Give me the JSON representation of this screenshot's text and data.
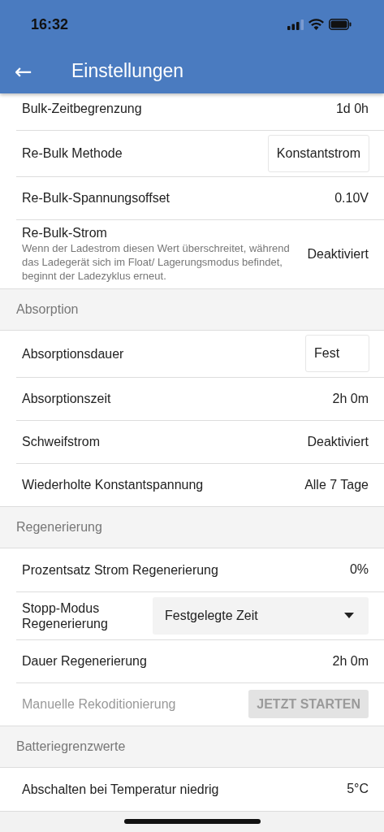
{
  "status_bar": {
    "time": "16:32"
  },
  "app_bar": {
    "back_icon": "←",
    "title": "Einstellungen"
  },
  "sections": [
    {
      "rows": [
        {
          "kind": "value",
          "label": "Bulk-Zeitbegrenzung",
          "value": "1d 0h"
        },
        {
          "kind": "box",
          "label": "Re-Bulk Methode",
          "value": "Konstantstrom"
        },
        {
          "kind": "value",
          "label": "Re-Bulk-Spannungsoffset",
          "value": "0.10V"
        },
        {
          "kind": "value",
          "label": "Re-Bulk-Strom",
          "description": "Wenn der Ladestrom diesen Wert überschreitet, während das Ladegerät sich im Float/ Lagerungsmodus befindet, beginnt der Ladezyklus erneut.",
          "value": "Deaktiviert"
        }
      ]
    },
    {
      "title": "Absorption",
      "rows": [
        {
          "kind": "box",
          "label": "Absorptionsdauer",
          "value": "Fest"
        },
        {
          "kind": "value",
          "label": "Absorptionszeit",
          "value": "2h 0m"
        },
        {
          "kind": "value",
          "label": "Schweifstrom",
          "value": "Deaktiviert"
        },
        {
          "kind": "value",
          "label": "Wiederholte Konstantspannung",
          "value": "Alle 7 Tage"
        }
      ]
    },
    {
      "title": "Regenerierung",
      "rows": [
        {
          "kind": "value",
          "label": "Prozentsatz Strom Regenerierung",
          "value": "0%"
        },
        {
          "kind": "select",
          "label": "Stopp-Modus Regenerierung",
          "value": "Festgelegte Zeit"
        },
        {
          "kind": "value",
          "label": "Dauer Regenerierung",
          "value": "2h 0m"
        },
        {
          "kind": "action",
          "label": "Manuelle Rekoditionierung",
          "button": "JETZT STARTEN",
          "disabled": true
        }
      ]
    },
    {
      "title": "Batteriegrenzwerte",
      "rows": [
        {
          "kind": "value",
          "label": "Abschalten bei Temperatur niedrig",
          "value": "5°C"
        }
      ]
    }
  ]
}
